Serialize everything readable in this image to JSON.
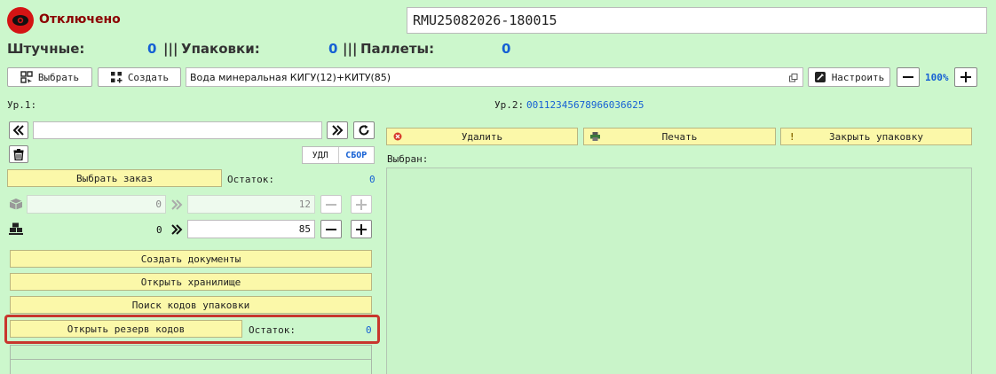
{
  "status": {
    "label": "Отключено"
  },
  "session_id": "RMU25082026-180015",
  "counters": {
    "pieces_label": "Штучные:",
    "pieces_value": "0",
    "packs_label": "Упаковки:",
    "packs_value": "0",
    "pallets_label": "Паллеты:",
    "pallets_value": "0",
    "separator": "|||"
  },
  "toolbar": {
    "select_label": "Выбрать",
    "create_label": "Создать",
    "product": "Вода минеральная КИГУ(12)+КИТУ(85)",
    "settings_label": "Настроить",
    "zoom": "100%"
  },
  "levels": {
    "level1_label": "Ур.1:",
    "level2_label": "Ур.2:",
    "level2_value": "00112345678966036625"
  },
  "left": {
    "toggle_del": "УДЛ",
    "toggle_collect": "СБОР",
    "select_order_label": "Выбрать заказ",
    "remainder_label": "Остаток:",
    "remainder_value": "0",
    "row1_count": "0",
    "row1_qty": "12",
    "row2_count": "0",
    "row2_qty": "85",
    "create_docs_label": "Создать документы",
    "open_storage_label": "Открыть хранилище",
    "search_codes_label": "Поиск кодов упаковки",
    "open_reserve_label": "Открыть резерв кодов",
    "reserve_remainder_label": "Остаток:",
    "reserve_remainder_value": "0"
  },
  "right": {
    "delete_label": "Удалить",
    "print_label": "Печать",
    "close_pack_label": "Закрыть упаковку",
    "close_pack_icon": "!",
    "selected_label": "Выбран:"
  },
  "colors": {
    "background": "#ccf7cc",
    "button_yellow": "#fbf8a9",
    "accent_blue": "#1560d4",
    "status_red": "#d41414",
    "highlight_red": "#c8362d"
  }
}
